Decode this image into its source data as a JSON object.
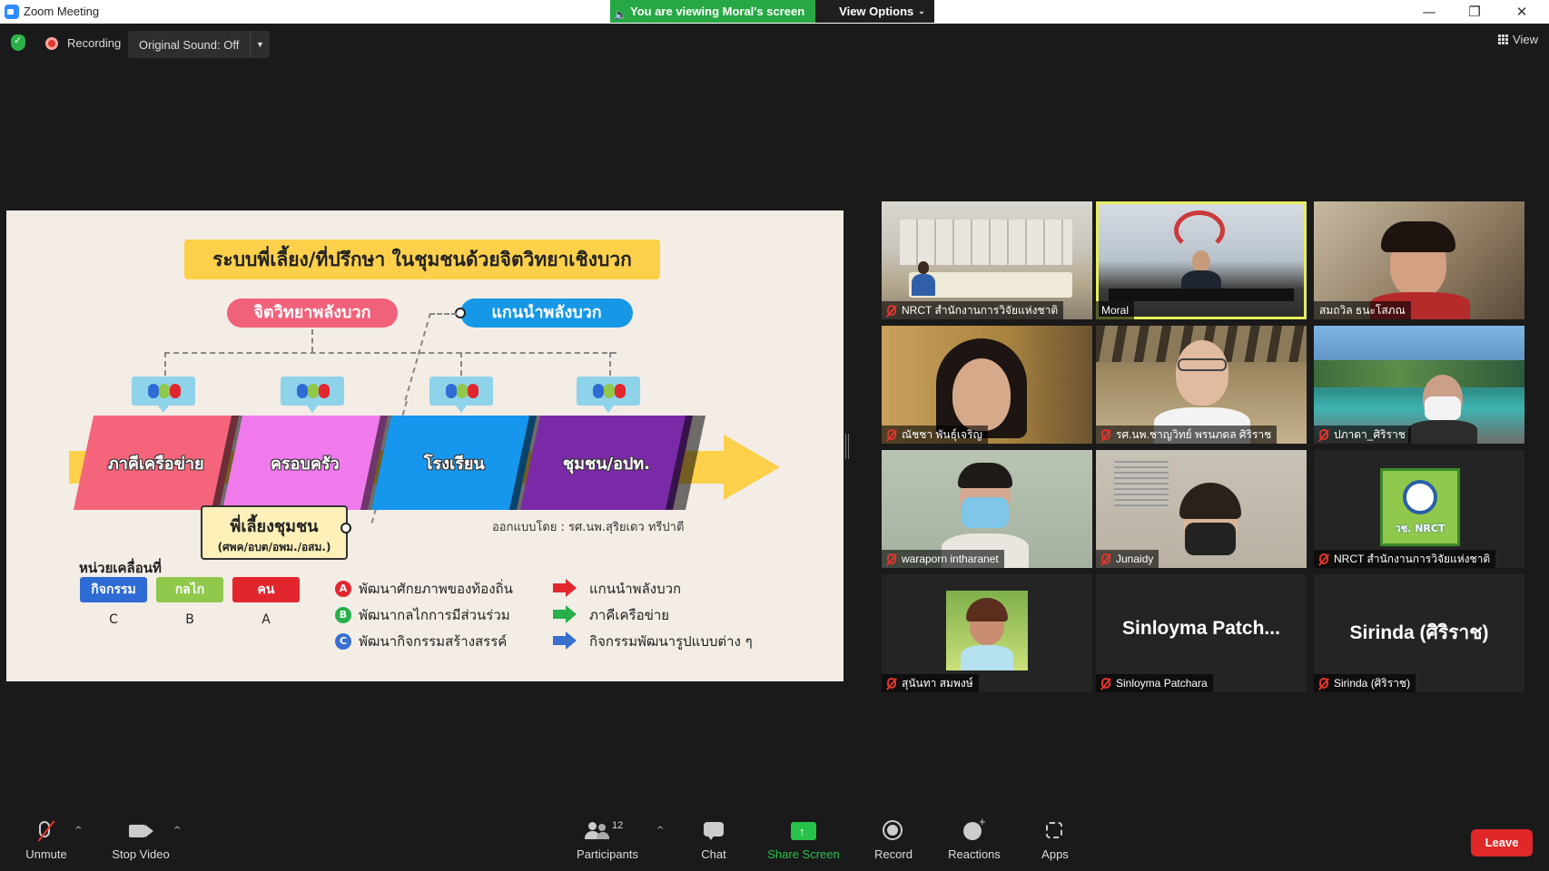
{
  "window": {
    "title": "Zoom Meeting"
  },
  "banner": {
    "viewing_text": "You are viewing Moral's screen",
    "view_options": "View Options"
  },
  "top_bar": {
    "recording": "Recording",
    "original_sound": "Original Sound: Off",
    "view": "View"
  },
  "slide": {
    "title": "ระบบพี่เลี้ยง/ที่ปรึกษา ในชุมชนด้วยจิตวิทยาเชิงบวก",
    "pill_left": "จิตวิทยาพลังบวก",
    "pill_right": "แกนนำพลังบวก",
    "segments": [
      "ภาคีเครือข่าย",
      "ครอบครัว",
      "โรงเรียน",
      "ชุมชน/อปท."
    ],
    "mentor_title": "พี่เลี้ยงชุมชน",
    "mentor_sub": "(ศพค/อบต/อพม./อสม.)",
    "design_credit": "ออกแบบโดย : รศ.นพ.สุริยเดว ทรีปาตี",
    "unit_title": "หน่วยเคลื่อนที่",
    "units": [
      {
        "label": "กิจกรรม",
        "letter": "C",
        "color": "#2e6bd4"
      },
      {
        "label": "กลไก",
        "letter": "B",
        "color": "#8fc84a"
      },
      {
        "label": "คน",
        "letter": "A",
        "color": "#e2262e"
      }
    ],
    "legend": [
      {
        "bullet": "A",
        "text": "พัฒนาศักยภาพของท้องถิ่น",
        "out": "แกนนำพลังบวก",
        "color": "#e2262e"
      },
      {
        "bullet": "B",
        "text": "พัฒนากลไกการมีส่วนร่วม",
        "out": "ภาคีเครือข่าย",
        "color": "#27b04a"
      },
      {
        "bullet": "C",
        "text": "พัฒนากิจกรรมสร้างสรรค์",
        "out": "กิจกรรมพัฒนารูปแบบต่าง ๆ",
        "color": "#3a6fd0"
      }
    ]
  },
  "participants_tiles": [
    {
      "name": "NRCT สำนักงานการวิจัยแห่งชาติ"
    },
    {
      "name": "Moral"
    },
    {
      "name": "สมถวิล ธนะโสภณ"
    },
    {
      "name": "ณัชชา พันธุ์เจริญ"
    },
    {
      "name": "รศ.นพ.ชาญวิทย์ พรนภดล ศิริราช"
    },
    {
      "name": "ปภาดา_ศิริราช"
    },
    {
      "name": "waraporn intharanet"
    },
    {
      "name": "Junaidy"
    },
    {
      "name": "NRCT สำนักงานการวิจัยแห่งชาติ",
      "logo": "วช. NRCT"
    },
    {
      "name": "สุนันทา สมพงษ์"
    },
    {
      "name": "Sinloyma Patchara",
      "display": "Sinloyma  Patch..."
    },
    {
      "name": "Sirinda (ศิริราช)",
      "display": "Sirinda (ศิริราช)"
    }
  ],
  "toolbar": {
    "unmute": "Unmute",
    "stop_video": "Stop Video",
    "participants": "Participants",
    "participant_count": "12",
    "chat": "Chat",
    "share_screen": "Share Screen",
    "record": "Record",
    "reactions": "Reactions",
    "apps": "Apps",
    "leave": "Leave"
  }
}
